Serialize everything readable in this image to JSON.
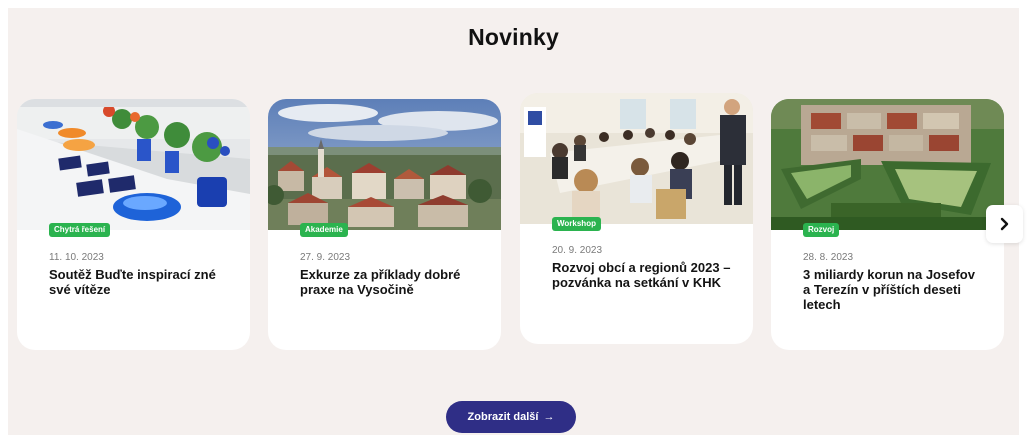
{
  "section": {
    "title": "Novinky"
  },
  "cards": [
    {
      "tag": "Chytrá řešení",
      "date": "11. 10. 2023",
      "title": "Soutěž Buďte inspirací zné své vítěze",
      "image": "award-table-photo"
    },
    {
      "tag": "Akademie",
      "date": "27. 9. 2023",
      "title": "Exkurze za příklady dobré praxe na Vysočině",
      "image": "town-panorama-photo"
    },
    {
      "tag": "Workshop",
      "date": "20. 9. 2023",
      "title": "Rozvoj obcí a regionů 2023 – pozvánka na setkání v KHK",
      "image": "conference-room-photo"
    },
    {
      "tag": "Rozvoj",
      "date": "28. 8. 2023",
      "title": "3 miliardy korun na Josefov a Terezín v příštích deseti letech",
      "image": "fortress-aerial-photo"
    }
  ],
  "carousel": {
    "next_icon": "chevron-right-icon"
  },
  "more_button": {
    "label": "Zobrazit další",
    "icon": "→"
  },
  "colors": {
    "section_background": "#f5f0ee",
    "tag_green": "#2bb34f",
    "button_navy": "#2f2e86"
  }
}
